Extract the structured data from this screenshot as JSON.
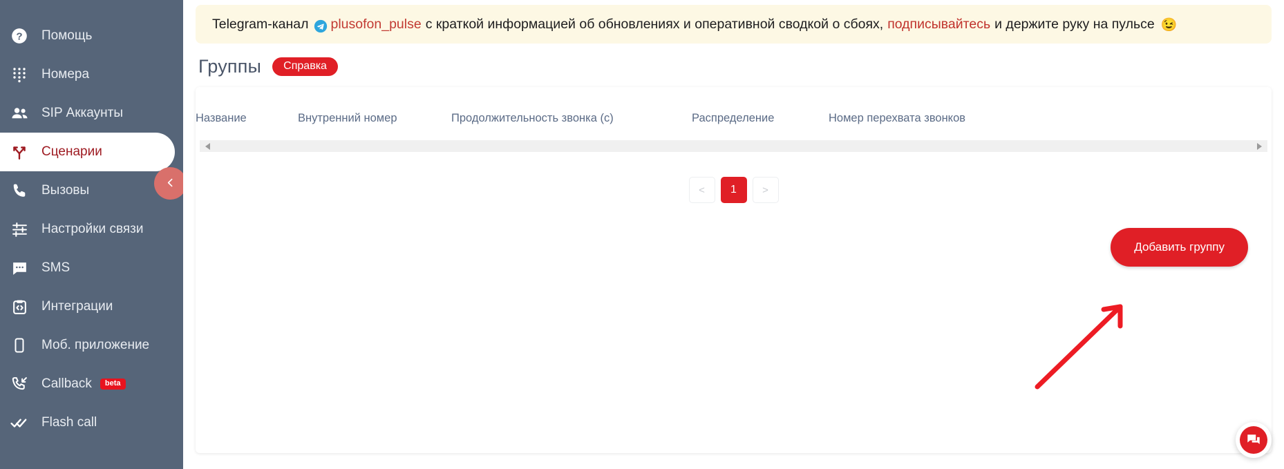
{
  "sidebar": {
    "collapse_button": {
      "label": "‹",
      "icon": "chevron-left-icon"
    },
    "items": [
      {
        "label": "Помощь",
        "icon": "question-circle-icon",
        "active": false
      },
      {
        "label": "Номера",
        "icon": "dialpad-icon",
        "active": false
      },
      {
        "label": "SIP Аккаунты",
        "icon": "users-icon",
        "active": false
      },
      {
        "label": "Сценарии",
        "icon": "branch-arrows-icon",
        "active": true
      },
      {
        "label": "Вызовы",
        "icon": "phone-icon",
        "active": false
      },
      {
        "label": "Настройки связи",
        "icon": "sliders-icon",
        "active": false
      },
      {
        "label": "SMS",
        "icon": "chat-bubble-icon",
        "active": false
      },
      {
        "label": "Интеграции",
        "icon": "code-clipboard-icon",
        "active": false
      },
      {
        "label": "Моб. приложение",
        "icon": "mobile-phone-icon",
        "active": false
      },
      {
        "label": "Callback",
        "icon": "callback-phone-icon",
        "active": false,
        "badge": "beta"
      },
      {
        "label": "Flash call",
        "icon": "double-check-icon",
        "active": false
      }
    ]
  },
  "banner": {
    "text_before": "Telegram-канал",
    "icon": "telegram-icon",
    "link": "plusofon_pulse",
    "text_middle": "с краткой информацией об обновлениях и оперативной сводкой о сбоях,",
    "link2": "подписывайтесь",
    "text_after": "и держите руку на пульсе",
    "emoji": "😉"
  },
  "page": {
    "title": "Группы",
    "help_badge": "Справка"
  },
  "table": {
    "columns": [
      "Название",
      "Внутренний номер",
      "Продолжительность звонка (с)",
      "Распределение",
      "Номер перехвата звонков"
    ],
    "rows": []
  },
  "scrollbar": {
    "left_arrow": "◀",
    "right_arrow": "▶"
  },
  "pagination": {
    "prev": "<",
    "next": ">",
    "pages": [
      "1"
    ],
    "current": "1"
  },
  "actions": {
    "add_group": "Добавить группу"
  },
  "chat_widget": {
    "icon": "chat-bubbles-icon"
  },
  "colors": {
    "sidebar_bg": "#566579",
    "accent_red": "#e01f26",
    "active_text": "#9e1b22",
    "banner_bg": "#fdf8e4",
    "collapse_btn": "#d9706b",
    "annotation_arrow": "#ed1c24"
  }
}
